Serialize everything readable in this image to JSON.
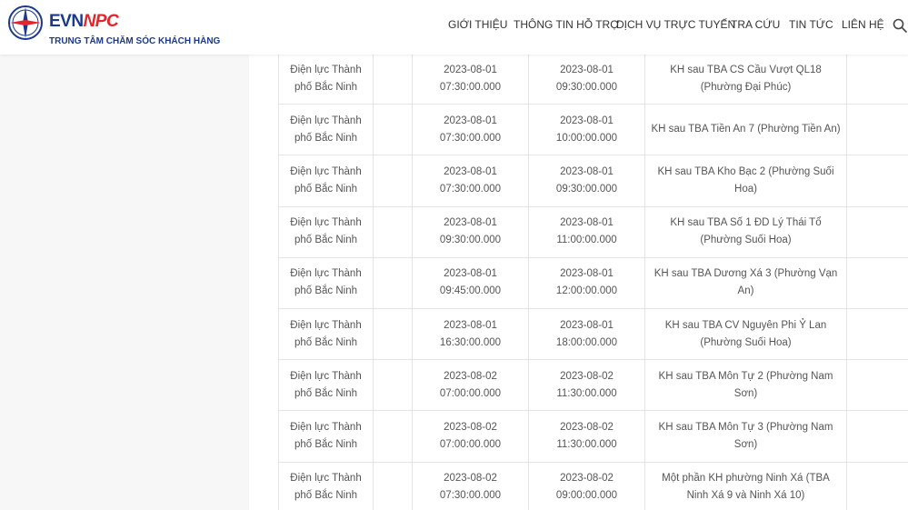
{
  "brand": {
    "evn": "EVN",
    "npc": "NPC",
    "subtitle": "TRUNG TÂM CHĂM SÓC KHÁCH HÀNG",
    "colors": {
      "primary": "#1a3a8f",
      "accent": "#e2262b"
    }
  },
  "nav": {
    "items": [
      "Giới thiệu",
      "Thông tin hỗ trợ",
      "Dịch vụ trực tuyến",
      "Tra cứu",
      "Tin tức",
      "Liên hệ"
    ],
    "search_icon": "search-icon"
  },
  "table": {
    "rows": [
      {
        "unit": "Điện lực Thành phố Bắc Ninh",
        "start_date": "2023-08-01",
        "start_time": "07:30:00.000",
        "end_date": "2023-08-01",
        "end_time": "09:30:00.000",
        "area": "KH sau TBA CS Cầu Vượt QL18 (Phường Đại Phúc)"
      },
      {
        "unit": "Điện lực Thành phố Bắc Ninh",
        "start_date": "2023-08-01",
        "start_time": "07:30:00.000",
        "end_date": "2023-08-01",
        "end_time": "10:00:00.000",
        "area": "KH sau TBA Tiền An 7 (Phường Tiền An)"
      },
      {
        "unit": "Điện lực Thành phố Bắc Ninh",
        "start_date": "2023-08-01",
        "start_time": "07:30:00.000",
        "end_date": "2023-08-01",
        "end_time": "09:30:00.000",
        "area": "KH sau TBA Kho Bạc 2 (Phường Suối Hoa)"
      },
      {
        "unit": "Điện lực Thành phố Bắc Ninh",
        "start_date": "2023-08-01",
        "start_time": "09:30:00.000",
        "end_date": "2023-08-01",
        "end_time": "11:00:00.000",
        "area": "KH sau TBA Số 1 ĐD Lý Thái Tổ (Phường Suối Hoa)"
      },
      {
        "unit": "Điện lực Thành phố Bắc Ninh",
        "start_date": "2023-08-01",
        "start_time": "09:45:00.000",
        "end_date": "2023-08-01",
        "end_time": "12:00:00.000",
        "area": "KH sau TBA Dương Xá 3 (Phường Vạn An)"
      },
      {
        "unit": "Điện lực Thành phố Bắc Ninh",
        "start_date": "2023-08-01",
        "start_time": "16:30:00.000",
        "end_date": "2023-08-01",
        "end_time": "18:00:00.000",
        "area": "KH sau TBA CV Nguyên Phi Ỷ Lan (Phường Suối Hoa)"
      },
      {
        "unit": "Điện lực Thành phố Bắc Ninh",
        "start_date": "2023-08-02",
        "start_time": "07:00:00.000",
        "end_date": "2023-08-02",
        "end_time": "11:30:00.000",
        "area": "KH sau TBA Môn Tự 2 (Phường Nam Sơn)"
      },
      {
        "unit": "Điện lực Thành phố Bắc Ninh",
        "start_date": "2023-08-02",
        "start_time": "07:00:00.000",
        "end_date": "2023-08-02",
        "end_time": "11:30:00.000",
        "area": "KH sau TBA Môn Tự 3 (Phường Nam Sơn)"
      },
      {
        "unit": "Điện lực Thành phố Bắc Ninh",
        "start_date": "2023-08-02",
        "start_time": "07:30:00.000",
        "end_date": "2023-08-02",
        "end_time": "09:00:00.000",
        "area": "Một phần KH phường Ninh Xá (TBA Ninh Xá 9 và Ninh Xá 10)"
      }
    ]
  }
}
